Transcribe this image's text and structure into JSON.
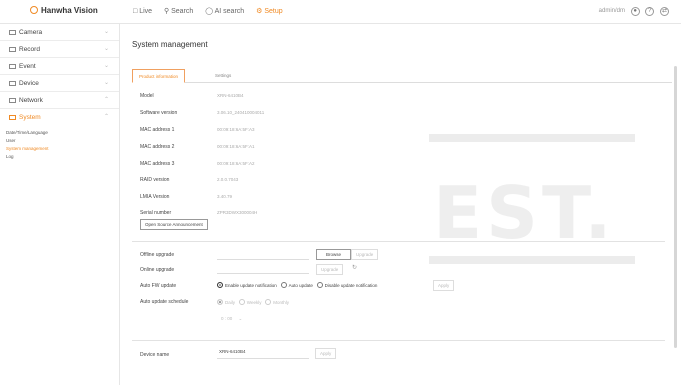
{
  "header": {
    "logo_text": "Hanwha Vision",
    "nav": [
      {
        "icon": "monitor-icon",
        "label": "Live"
      },
      {
        "icon": "search-icon",
        "label": "Search"
      },
      {
        "icon": "ai-search-icon",
        "label": "AI search"
      },
      {
        "icon": "gear-icon",
        "label": "Setup"
      }
    ],
    "user_text": "admin/dm",
    "right_icons": [
      "user-icon",
      "help-icon",
      "export-icon"
    ]
  },
  "sidebar": {
    "items": [
      {
        "icon": "camera-icon",
        "label": "Camera"
      },
      {
        "icon": "record-icon",
        "label": "Record"
      },
      {
        "icon": "event-icon",
        "label": "Event"
      },
      {
        "icon": "device-icon",
        "label": "Device"
      },
      {
        "icon": "network-icon",
        "label": "Network"
      },
      {
        "icon": "system-icon",
        "label": "System"
      }
    ],
    "system_sub": [
      "Date/Time/Language",
      "User",
      "System management",
      "Log"
    ]
  },
  "page": {
    "title": "System management",
    "tabs": [
      "Product information",
      "Settings"
    ]
  },
  "info": [
    {
      "label": "Model",
      "value": "XRN-6410B4"
    },
    {
      "label": "Software version",
      "value": "3.06.10_240410004011"
    },
    {
      "label": "MAC address 1",
      "value": "00:09:18:6A:5F:A3"
    },
    {
      "label": "MAC address 2",
      "value": "00:09:18:6A:5F:A1"
    },
    {
      "label": "MAC address 3",
      "value": "00:09:18:6A:5F:A2"
    },
    {
      "label": "RAID version",
      "value": "2.0.0.7043"
    },
    {
      "label": "LMIA Version",
      "value": "3.40.79"
    },
    {
      "label": "Serial number",
      "value": "ZPR3DWX300004H"
    }
  ],
  "open_source_button": "Open Source Announcement",
  "upgrade": {
    "offline_label": "Offline upgrade",
    "online_label": "Online upgrade",
    "browse": "Browse",
    "upgrade": "Upgrade",
    "upgrade2": "Upgrade"
  },
  "auto_fw": {
    "label": "Auto FW update",
    "options": [
      "Enable update notification",
      "Auto update",
      "Disable update notification"
    ],
    "apply": "Apply"
  },
  "auto_schedule": {
    "label": "Auto update schedule",
    "options": [
      "Daily",
      "Weekly",
      "Monthly"
    ],
    "time": "0 : 00"
  },
  "device_name": {
    "label": "Device name",
    "value": "XRN-6410B4",
    "apply": "Apply"
  },
  "watermark": "EST.",
  "colors": {
    "accent": "#f08a24",
    "text": "#333333",
    "muted": "#aaaaaa"
  }
}
